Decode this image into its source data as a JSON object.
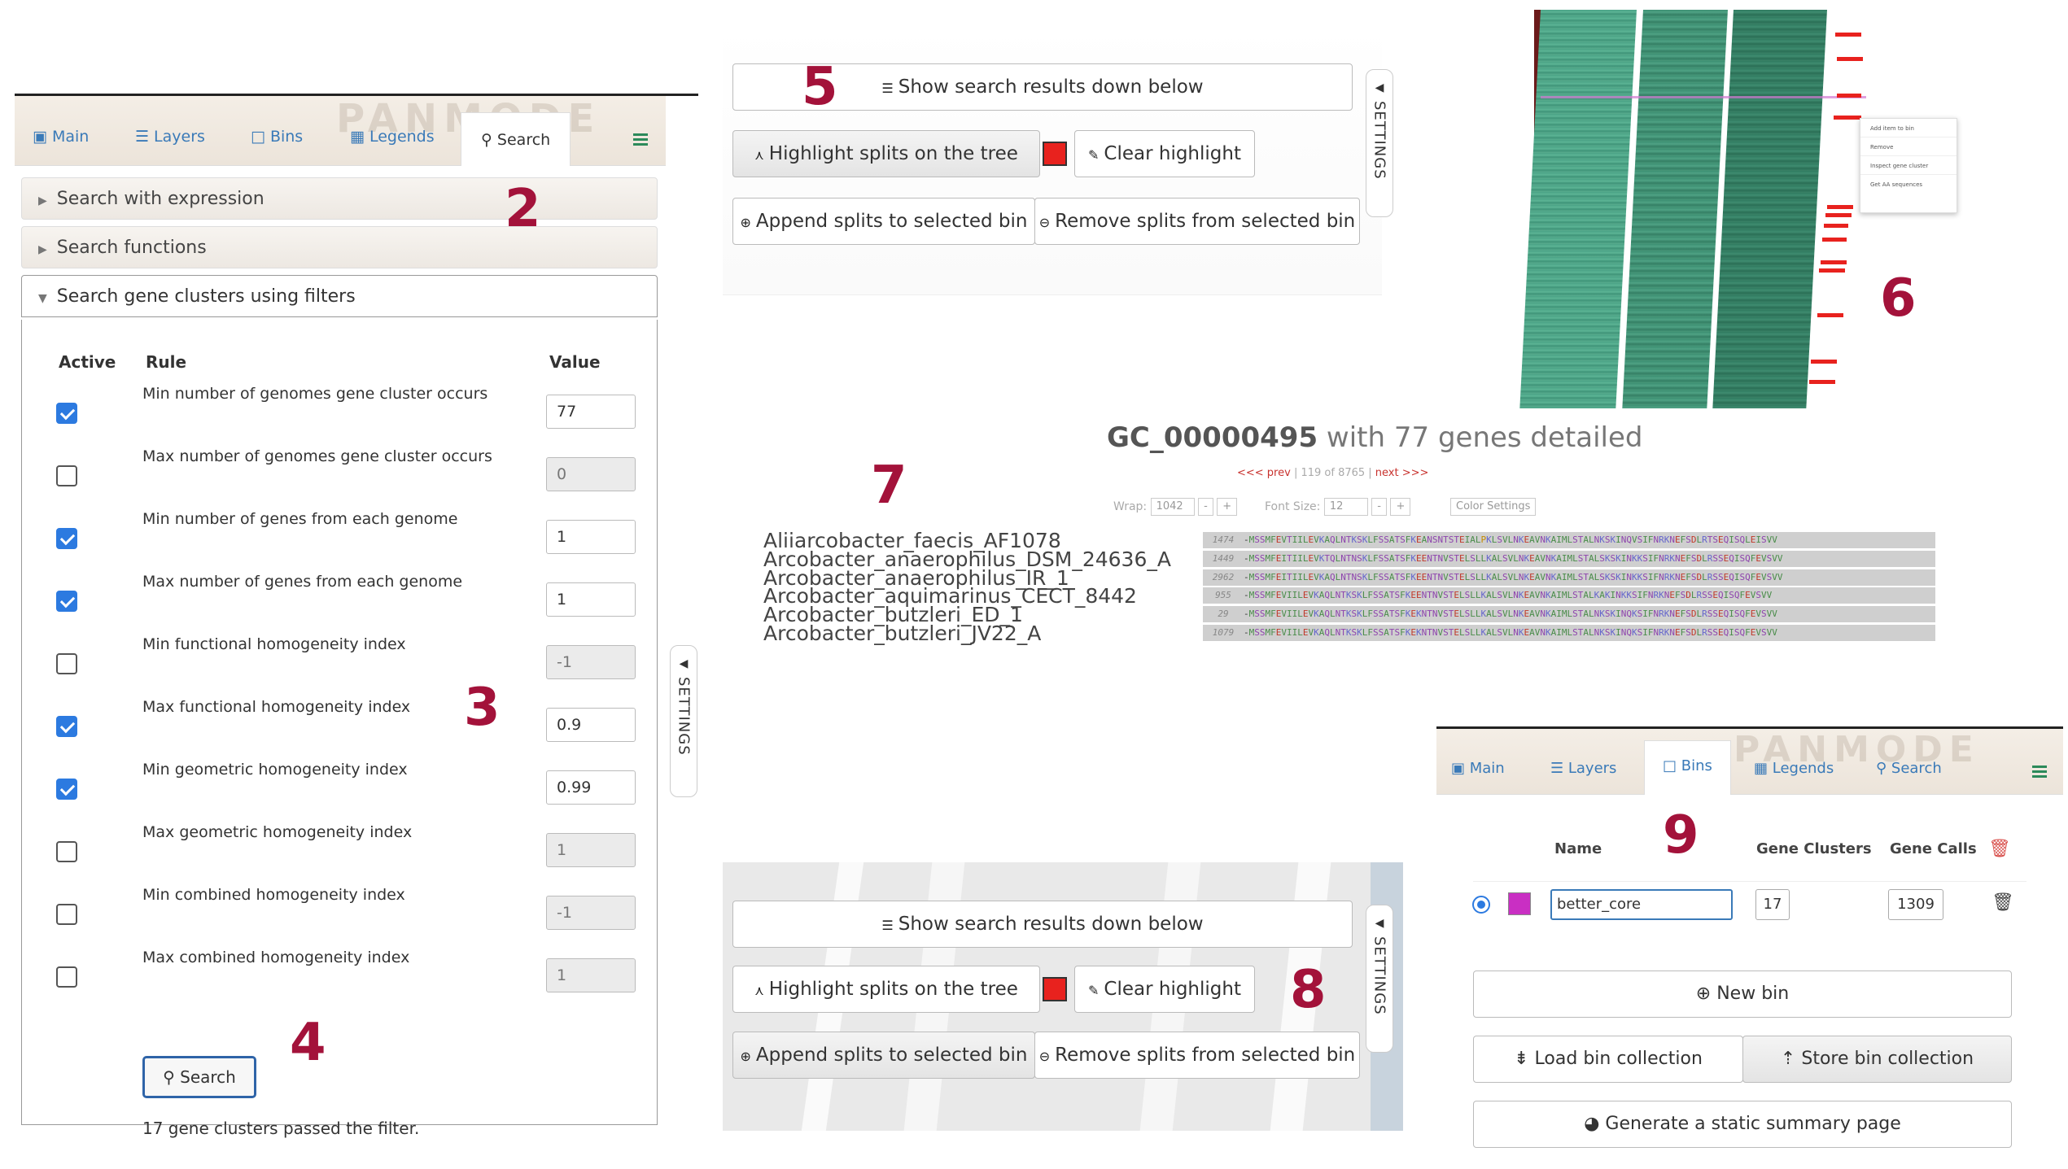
{
  "markers": {
    "m2": "2",
    "m3": "3",
    "m4": "4",
    "m5": "5",
    "m6": "6",
    "m7": "7",
    "m8": "8",
    "m9": "9"
  },
  "watermark": "PANMODE",
  "search_panel": {
    "tabs": [
      "Main",
      "Layers",
      "Bins",
      "Legends",
      "Search"
    ],
    "active_tab": "Search",
    "accordions": [
      "Search with expression",
      "Search functions",
      "Search gene clusters using filters"
    ],
    "headers": {
      "active": "Active",
      "rule": "Rule",
      "value": "Value"
    },
    "rules": [
      {
        "label": "Min number of genomes gene cluster occurs",
        "value": "77",
        "checked": true
      },
      {
        "label": "Max number of genomes gene cluster occurs",
        "value": "0",
        "checked": false
      },
      {
        "label": "Min number of genes from each genome",
        "value": "1",
        "checked": true
      },
      {
        "label": "Max number of genes from each genome",
        "value": "1",
        "checked": true
      },
      {
        "label": "Min functional homogeneity index",
        "value": "-1",
        "checked": false
      },
      {
        "label": "Max functional homogeneity index",
        "value": "0.9",
        "checked": true
      },
      {
        "label": "Min geometric homogeneity index",
        "value": "0.99",
        "checked": true
      },
      {
        "label": "Max geometric homogeneity index",
        "value": "1",
        "checked": false
      },
      {
        "label": "Min combined homogeneity index",
        "value": "-1",
        "checked": false
      },
      {
        "label": "Max combined homogeneity index",
        "value": "1",
        "checked": false
      }
    ],
    "search_button": "Search",
    "result_text": "17 gene clusters passed the filter.",
    "settings_label": "SETTINGS"
  },
  "toolbar": {
    "show_results": "Show search results down below",
    "highlight": "Highlight splits on the tree",
    "clear": "Clear highlight",
    "append": "Append splits to selected bin",
    "remove": "Remove splits from selected bin",
    "settings_label": "SETTINGS",
    "highlight_color": "#e8221e"
  },
  "context_menu": [
    "Add item to bin",
    "Remove",
    "Inspect gene cluster",
    "Get AA sequences"
  ],
  "gene_cluster": {
    "id": "GC_00000495",
    "title_rest": " with 77 genes detailed",
    "prev": "<<< prev",
    "position": " | 119 of 8765 | ",
    "next": "next >>>",
    "wrap_label": "Wrap:",
    "wrap_value": "1042",
    "font_label": "Font Size:",
    "font_value": "12",
    "minus": "-",
    "plus": "+",
    "color_settings": "Color Settings",
    "genomes": [
      {
        "name": "Aliiarcobacter_faecis_AF1078",
        "num": "1474",
        "seq": "-MSSMFEVTIILEVKAQLNTKSKLFSSATSFKEANSNTSTEIALPKLSVLNKEAVNKAIMLSTALNKSKINQVSIFNRKNEFSDLRTSEQISQLEISVV"
      },
      {
        "name": "Arcobacter_anaerophilus_DSM_24636_A",
        "num": "1449",
        "seq": "-MSSMFEITIILEVKTQLNTNSKLFSSATSFKEENTNVSTELSLLKALSVLNKEAVNKAIMLSTALSKSKINKKSIFNRKNEFSDLRSSEQISQFEVSVV"
      },
      {
        "name": "Arcobacter_anaerophilus_IR_1",
        "num": "2962",
        "seq": "-MSSMFEITIILEVKAQLNTNSKLFSSATSFKEENTNVSTELSLLKALSVLNKEAVNKAIMLSTALSKSKINKKSIFNRKNEFSDLRSSEQISQFEVSVV"
      },
      {
        "name": "Arcobacter_aquimarinus_CECT_8442",
        "num": "955",
        "seq": "-MSSMFEVIILEVKAQLNTKSKLFSSATSFKEENTNVSTELSLLKALSVLNKEAVNKAIMLSTALKAKINKKSIFNRKNEFSDLRSSEQISQFEVSVV"
      },
      {
        "name": "Arcobacter_butzleri_ED_1",
        "num": "29",
        "seq": "-MSSMFEVIILEVKAQLNTKSKLFSSATSFKEKNTNVSTELSLLKALSVLNKEAVNKAIMLSTALNKSKINQKSIFNRKNEFSDLRSSEQISQFEVSVV"
      },
      {
        "name": "Arcobacter_butzleri_JV22_A",
        "num": "1079",
        "seq": "-MSSMFEVIILEVKAQLNTKSKLFSSATSFKEKNTNVSTELSLLKALSVLNKEAVNKAIMLSTALNKSKINQKSIFNRKNEFSDLRSSEQISQFEVSVV"
      }
    ]
  },
  "bins_panel": {
    "tabs": [
      "Main",
      "Layers",
      "Bins",
      "Legends",
      "Search"
    ],
    "active_tab": "Bins",
    "headers": {
      "name": "Name",
      "gene_clusters": "Gene Clusters",
      "gene_calls": "Gene Calls"
    },
    "bin": {
      "name": "better_core",
      "gene_clusters": "17",
      "gene_calls": "1309",
      "color": "#c92fc3"
    },
    "new_bin": "New bin",
    "load": "Load bin collection",
    "store": "Store bin collection",
    "summary": "Generate a static summary page"
  }
}
